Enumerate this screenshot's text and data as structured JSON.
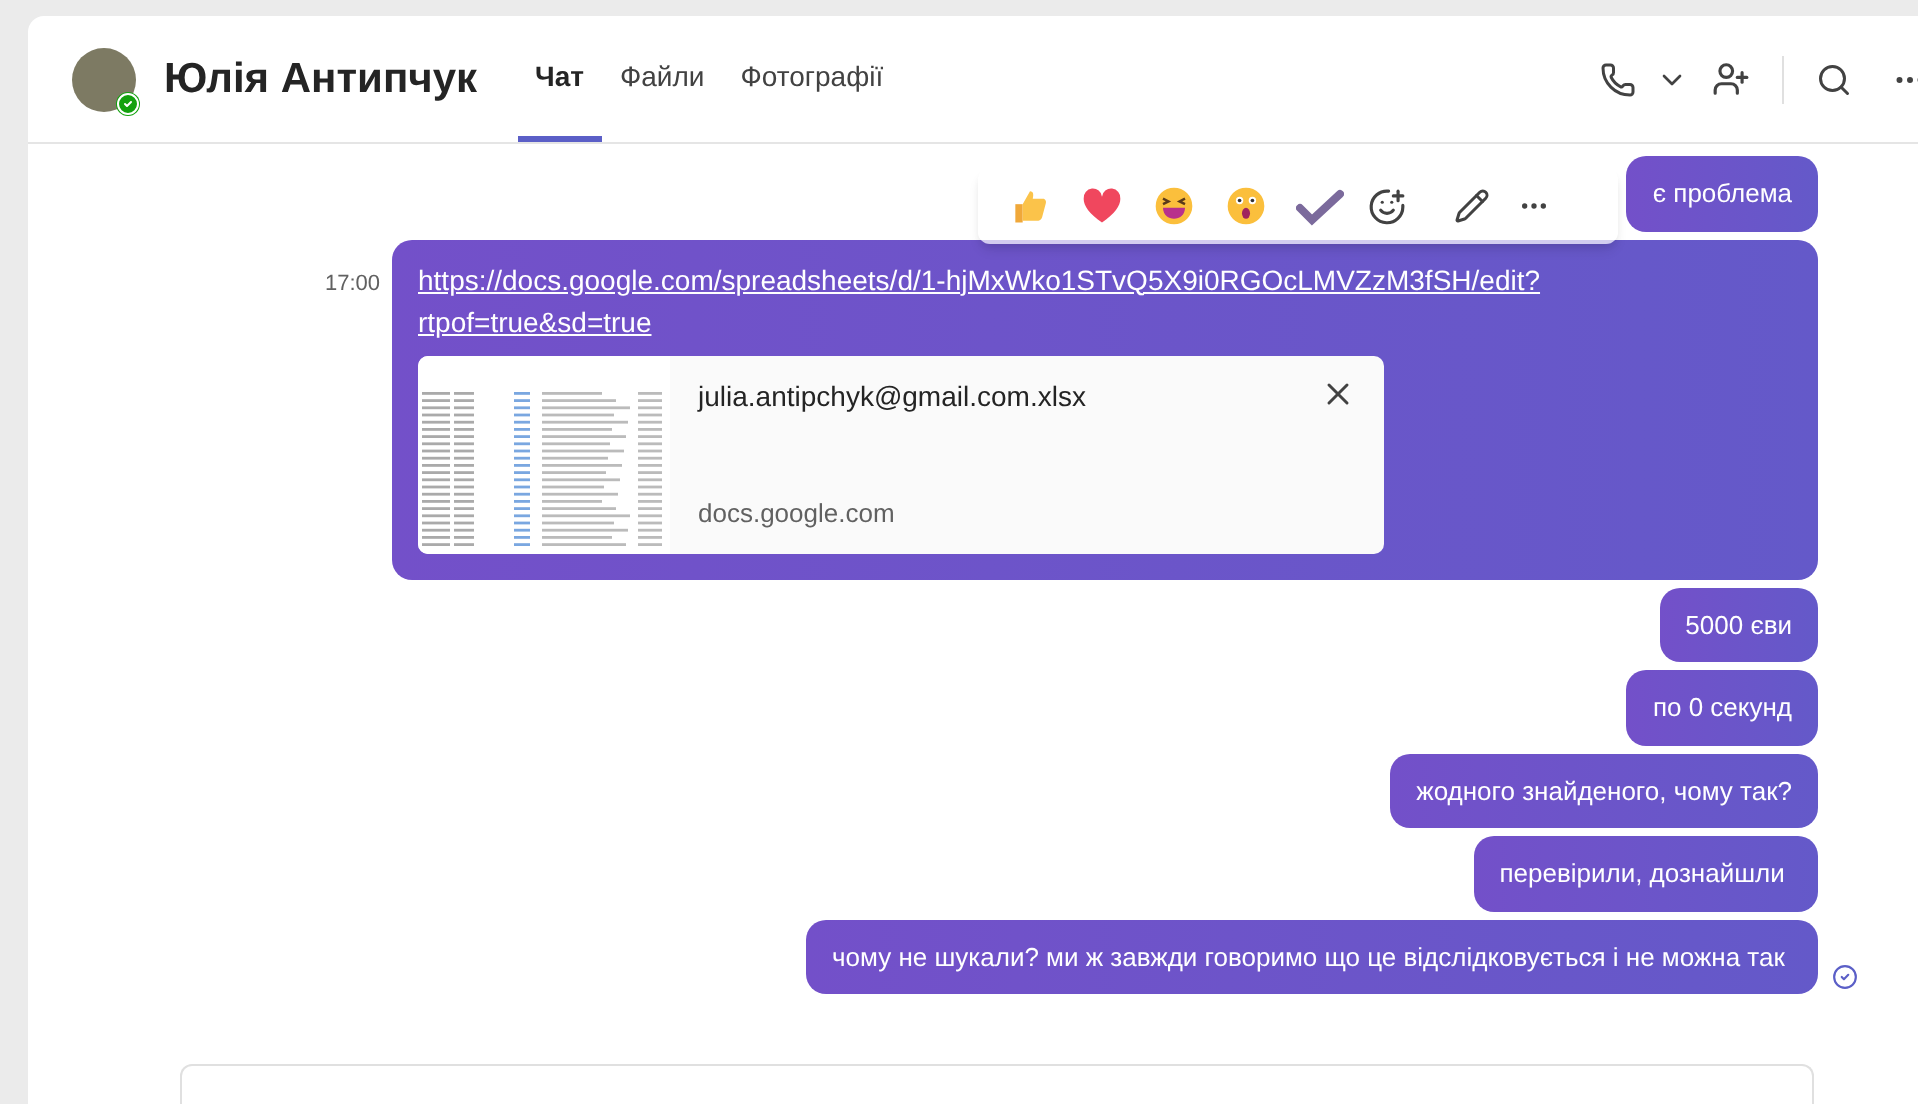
{
  "contact": {
    "name": "Юлія Антипчук",
    "online": true
  },
  "tabs": [
    {
      "label": "Чат",
      "selected": true
    },
    {
      "label": "Файли",
      "selected": false
    },
    {
      "label": "Фотографії",
      "selected": false
    }
  ],
  "messages": [
    {
      "kind": "text",
      "text": "є проблема",
      "hovered": true
    },
    {
      "kind": "link",
      "time": "17:00",
      "url": "https://docs.google.com/spreadsheets/d/1-hjMxWko1STvQ5X9i0RGOcLMVZzM3fSH/edit?rtpof=true&sd=true",
      "preview": {
        "title": "julia.antipchyk@gmail.com.xlsx",
        "domain": "docs.google.com"
      }
    },
    {
      "kind": "text",
      "text": "5000 єви"
    },
    {
      "kind": "text",
      "text": "по 0 секунд"
    },
    {
      "kind": "text",
      "text": "жодного знайденого, чому так?"
    },
    {
      "kind": "text",
      "text": "перевірили, дознайшли "
    },
    {
      "kind": "text",
      "text": "чому не шукали? ми ж завжди говоримо що це відслідковується і не можна так ",
      "read": true
    }
  ]
}
